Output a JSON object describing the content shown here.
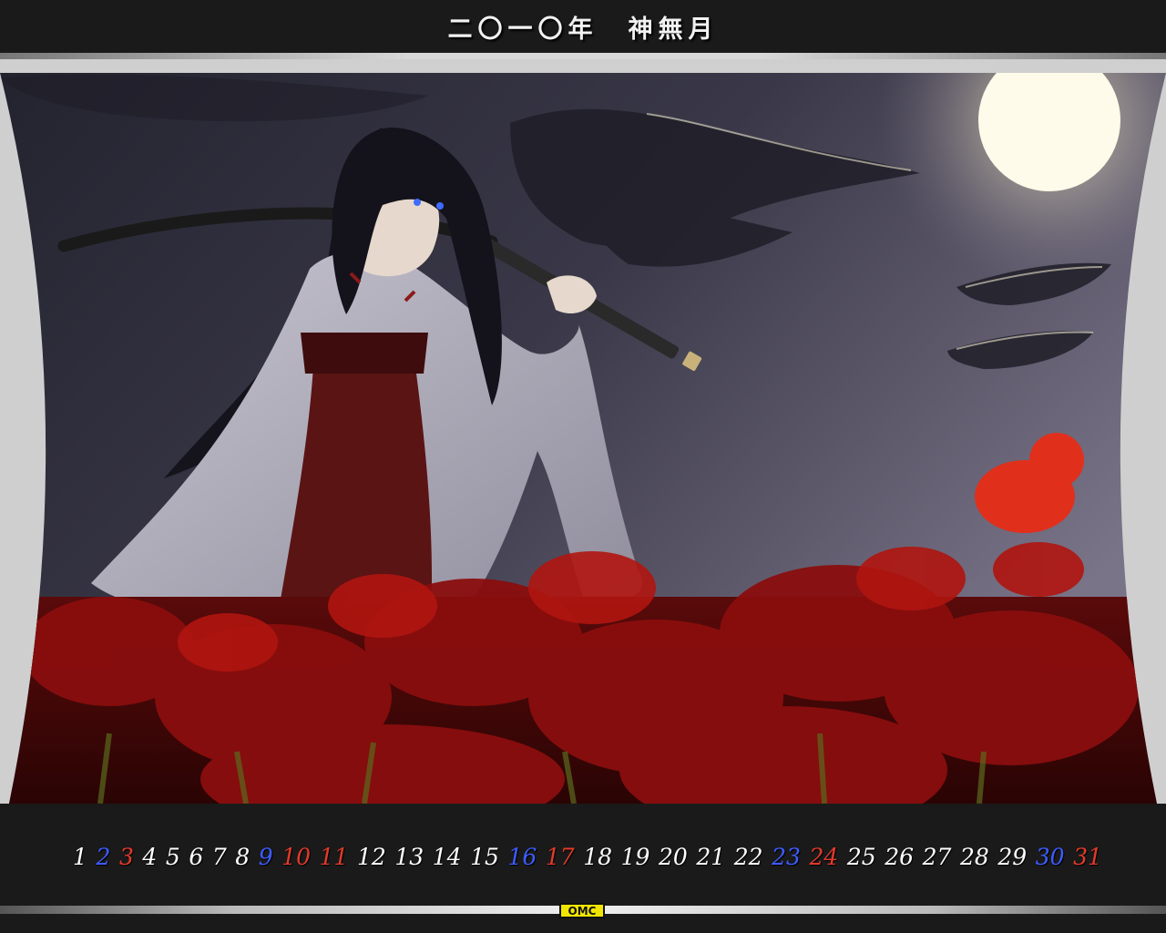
{
  "header": {
    "title": "二〇一〇年　神無月"
  },
  "artwork": {
    "name": "shrine-maiden-moonlit-illustration"
  },
  "calendar": {
    "dates": [
      {
        "label": "1",
        "color": "#ffffff"
      },
      {
        "label": "2",
        "color": "#3d5cff"
      },
      {
        "label": "3",
        "color": "#e23a2a"
      },
      {
        "label": "4",
        "color": "#ffffff"
      },
      {
        "label": "5",
        "color": "#ffffff"
      },
      {
        "label": "6",
        "color": "#ffffff"
      },
      {
        "label": "7",
        "color": "#ffffff"
      },
      {
        "label": "8",
        "color": "#ffffff"
      },
      {
        "label": "9",
        "color": "#3d5cff"
      },
      {
        "label": "10",
        "color": "#e23a2a"
      },
      {
        "label": "11",
        "color": "#e23a2a"
      },
      {
        "label": "12",
        "color": "#ffffff"
      },
      {
        "label": "13",
        "color": "#ffffff"
      },
      {
        "label": "14",
        "color": "#ffffff"
      },
      {
        "label": "15",
        "color": "#ffffff"
      },
      {
        "label": "16",
        "color": "#3d5cff"
      },
      {
        "label": "17",
        "color": "#e23a2a"
      },
      {
        "label": "18",
        "color": "#ffffff"
      },
      {
        "label": "19",
        "color": "#ffffff"
      },
      {
        "label": "20",
        "color": "#ffffff"
      },
      {
        "label": "21",
        "color": "#ffffff"
      },
      {
        "label": "22",
        "color": "#ffffff"
      },
      {
        "label": "23",
        "color": "#3d5cff"
      },
      {
        "label": "24",
        "color": "#e23a2a"
      },
      {
        "label": "25",
        "color": "#ffffff"
      },
      {
        "label": "26",
        "color": "#ffffff"
      },
      {
        "label": "27",
        "color": "#ffffff"
      },
      {
        "label": "28",
        "color": "#ffffff"
      },
      {
        "label": "29",
        "color": "#ffffff"
      },
      {
        "label": "30",
        "color": "#3d5cff"
      },
      {
        "label": "31",
        "color": "#e23a2a"
      }
    ]
  },
  "logo": {
    "text": "OMC",
    "color": "#f2e600"
  }
}
